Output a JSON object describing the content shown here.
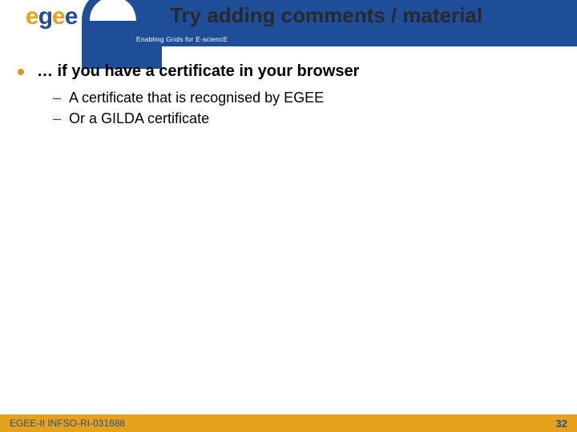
{
  "header": {
    "title": "Try adding comments / material",
    "subtitle": "Enabling Grids for E-sciencE"
  },
  "logo": {
    "text_html": "egee"
  },
  "body": {
    "bullet1": "… if you have a certificate in your browser",
    "sub": [
      "A certificate that is recognised by EGEE",
      "Or a GILDA certificate"
    ]
  },
  "footer": {
    "left": "EGEE-II INFSO-RI-031688",
    "page": "32"
  }
}
